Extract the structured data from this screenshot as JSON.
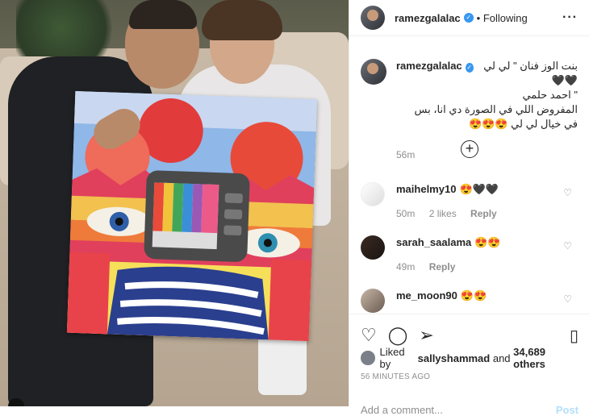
{
  "post": {
    "username": "ramezgalalac",
    "follow_status": "Following",
    "caption_lines": [
      "بنت الوز فنان \" لي لي 🖤🖤",
      "\" احمد حلمي",
      "المفروض اللي في الصورة دي انا، بس",
      "في خيال لي لي 😍😍😍"
    ],
    "caption_time": "56m"
  },
  "comments": [
    {
      "user": "maihelmy10",
      "text": "😍🖤🖤",
      "time": "50m",
      "likes": "2 likes",
      "reply": "Reply"
    },
    {
      "user": "sarah_saalama",
      "text": "😍😍",
      "time": "49m",
      "likes": "",
      "reply": "Reply"
    },
    {
      "user": "me_moon90",
      "text": "😍😍",
      "time": "",
      "likes": "",
      "reply": ""
    }
  ],
  "likes_line": {
    "prefix": "Liked by ",
    "user": "sallyshammad",
    "middle": " and ",
    "others": "34,689 others"
  },
  "timestamp": "56 MINUTES AGO",
  "add_comment": {
    "placeholder": "Add a comment...",
    "post": "Post"
  },
  "icons": {
    "more": "more-icon",
    "heart": "heart-icon",
    "comment": "comment-icon",
    "share": "share-icon",
    "save": "bookmark-icon",
    "load_more": "plus-circle-icon"
  }
}
